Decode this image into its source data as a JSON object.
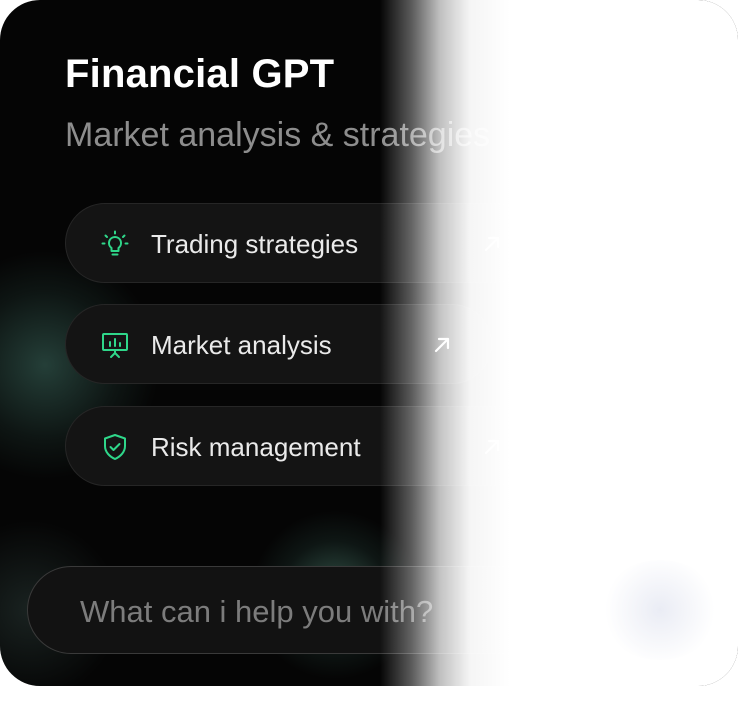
{
  "header": {
    "title": "Financial GPT",
    "subtitle": "Market analysis & strategies"
  },
  "suggestions": [
    {
      "label": "Trading strategies",
      "icon": "lightbulb-icon",
      "arrow_icon": "arrow-up-right-icon"
    },
    {
      "label": "Market analysis",
      "icon": "presentation-chart-icon",
      "arrow_icon": "arrow-up-right-icon"
    },
    {
      "label": "Risk management",
      "icon": "shield-check-icon",
      "arrow_icon": "arrow-up-right-icon"
    }
  ],
  "prompt": {
    "placeholder": "What can i help you with?"
  },
  "colors": {
    "accent": "#2fd78a",
    "background": "#050505",
    "pill": "#141414"
  }
}
